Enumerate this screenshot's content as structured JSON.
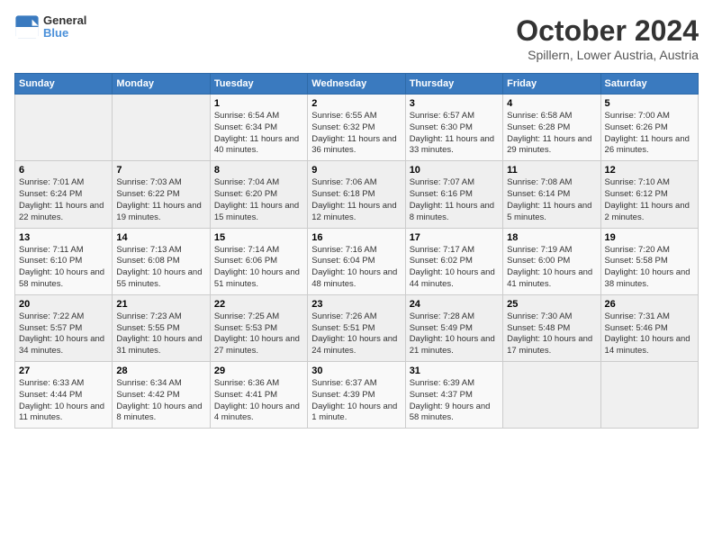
{
  "header": {
    "logo_line1": "General",
    "logo_line2": "Blue",
    "month": "October 2024",
    "location": "Spillern, Lower Austria, Austria"
  },
  "days_of_week": [
    "Sunday",
    "Monday",
    "Tuesday",
    "Wednesday",
    "Thursday",
    "Friday",
    "Saturday"
  ],
  "weeks": [
    [
      {
        "day": "",
        "info": ""
      },
      {
        "day": "",
        "info": ""
      },
      {
        "day": "1",
        "info": "Sunrise: 6:54 AM\nSunset: 6:34 PM\nDaylight: 11 hours and 40 minutes."
      },
      {
        "day": "2",
        "info": "Sunrise: 6:55 AM\nSunset: 6:32 PM\nDaylight: 11 hours and 36 minutes."
      },
      {
        "day": "3",
        "info": "Sunrise: 6:57 AM\nSunset: 6:30 PM\nDaylight: 11 hours and 33 minutes."
      },
      {
        "day": "4",
        "info": "Sunrise: 6:58 AM\nSunset: 6:28 PM\nDaylight: 11 hours and 29 minutes."
      },
      {
        "day": "5",
        "info": "Sunrise: 7:00 AM\nSunset: 6:26 PM\nDaylight: 11 hours and 26 minutes."
      }
    ],
    [
      {
        "day": "6",
        "info": "Sunrise: 7:01 AM\nSunset: 6:24 PM\nDaylight: 11 hours and 22 minutes."
      },
      {
        "day": "7",
        "info": "Sunrise: 7:03 AM\nSunset: 6:22 PM\nDaylight: 11 hours and 19 minutes."
      },
      {
        "day": "8",
        "info": "Sunrise: 7:04 AM\nSunset: 6:20 PM\nDaylight: 11 hours and 15 minutes."
      },
      {
        "day": "9",
        "info": "Sunrise: 7:06 AM\nSunset: 6:18 PM\nDaylight: 11 hours and 12 minutes."
      },
      {
        "day": "10",
        "info": "Sunrise: 7:07 AM\nSunset: 6:16 PM\nDaylight: 11 hours and 8 minutes."
      },
      {
        "day": "11",
        "info": "Sunrise: 7:08 AM\nSunset: 6:14 PM\nDaylight: 11 hours and 5 minutes."
      },
      {
        "day": "12",
        "info": "Sunrise: 7:10 AM\nSunset: 6:12 PM\nDaylight: 11 hours and 2 minutes."
      }
    ],
    [
      {
        "day": "13",
        "info": "Sunrise: 7:11 AM\nSunset: 6:10 PM\nDaylight: 10 hours and 58 minutes."
      },
      {
        "day": "14",
        "info": "Sunrise: 7:13 AM\nSunset: 6:08 PM\nDaylight: 10 hours and 55 minutes."
      },
      {
        "day": "15",
        "info": "Sunrise: 7:14 AM\nSunset: 6:06 PM\nDaylight: 10 hours and 51 minutes."
      },
      {
        "day": "16",
        "info": "Sunrise: 7:16 AM\nSunset: 6:04 PM\nDaylight: 10 hours and 48 minutes."
      },
      {
        "day": "17",
        "info": "Sunrise: 7:17 AM\nSunset: 6:02 PM\nDaylight: 10 hours and 44 minutes."
      },
      {
        "day": "18",
        "info": "Sunrise: 7:19 AM\nSunset: 6:00 PM\nDaylight: 10 hours and 41 minutes."
      },
      {
        "day": "19",
        "info": "Sunrise: 7:20 AM\nSunset: 5:58 PM\nDaylight: 10 hours and 38 minutes."
      }
    ],
    [
      {
        "day": "20",
        "info": "Sunrise: 7:22 AM\nSunset: 5:57 PM\nDaylight: 10 hours and 34 minutes."
      },
      {
        "day": "21",
        "info": "Sunrise: 7:23 AM\nSunset: 5:55 PM\nDaylight: 10 hours and 31 minutes."
      },
      {
        "day": "22",
        "info": "Sunrise: 7:25 AM\nSunset: 5:53 PM\nDaylight: 10 hours and 27 minutes."
      },
      {
        "day": "23",
        "info": "Sunrise: 7:26 AM\nSunset: 5:51 PM\nDaylight: 10 hours and 24 minutes."
      },
      {
        "day": "24",
        "info": "Sunrise: 7:28 AM\nSunset: 5:49 PM\nDaylight: 10 hours and 21 minutes."
      },
      {
        "day": "25",
        "info": "Sunrise: 7:30 AM\nSunset: 5:48 PM\nDaylight: 10 hours and 17 minutes."
      },
      {
        "day": "26",
        "info": "Sunrise: 7:31 AM\nSunset: 5:46 PM\nDaylight: 10 hours and 14 minutes."
      }
    ],
    [
      {
        "day": "27",
        "info": "Sunrise: 6:33 AM\nSunset: 4:44 PM\nDaylight: 10 hours and 11 minutes."
      },
      {
        "day": "28",
        "info": "Sunrise: 6:34 AM\nSunset: 4:42 PM\nDaylight: 10 hours and 8 minutes."
      },
      {
        "day": "29",
        "info": "Sunrise: 6:36 AM\nSunset: 4:41 PM\nDaylight: 10 hours and 4 minutes."
      },
      {
        "day": "30",
        "info": "Sunrise: 6:37 AM\nSunset: 4:39 PM\nDaylight: 10 hours and 1 minute."
      },
      {
        "day": "31",
        "info": "Sunrise: 6:39 AM\nSunset: 4:37 PM\nDaylight: 9 hours and 58 minutes."
      },
      {
        "day": "",
        "info": ""
      },
      {
        "day": "",
        "info": ""
      }
    ]
  ]
}
